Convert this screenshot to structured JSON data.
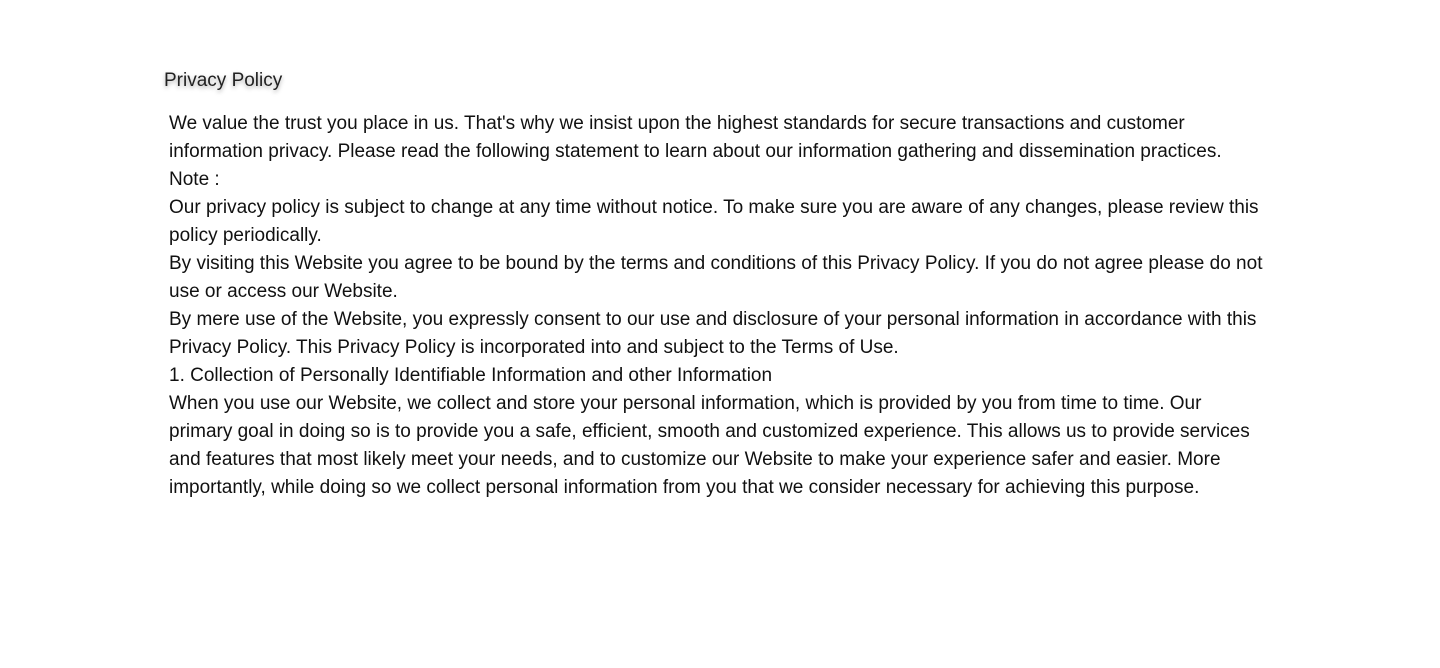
{
  "policy": {
    "title": "Privacy Policy",
    "paragraphs": [
      "We value the trust you place in us. That's why we insist upon the highest standards for secure transactions and customer information privacy. Please read the following statement to learn about our information gathering and dissemination practices.",
      "Note :",
      "Our privacy policy is subject to change at any time without notice. To make sure you are aware of any changes, please review this policy periodically.",
      "By visiting this Website you agree to be bound by the terms and conditions of this Privacy Policy. If you do not agree please do not use or access our Website.",
      "By mere use of the Website, you expressly consent to our use and disclosure of your personal information in accordance with this Privacy Policy. This Privacy Policy is incorporated into and subject to the Terms of Use.",
      "1. Collection of Personally Identifiable Information and other Information",
      "When you use our Website, we collect and store your personal information, which is provided by you from time to time. Our primary goal in doing so is to provide you a safe, efficient, smooth and customized experience. This allows us to provide services and features that most likely meet your needs, and to customize our Website to make your experience safer and easier. More importantly, while doing so we collect personal information from you that we consider necessary for achieving this purpose."
    ]
  }
}
